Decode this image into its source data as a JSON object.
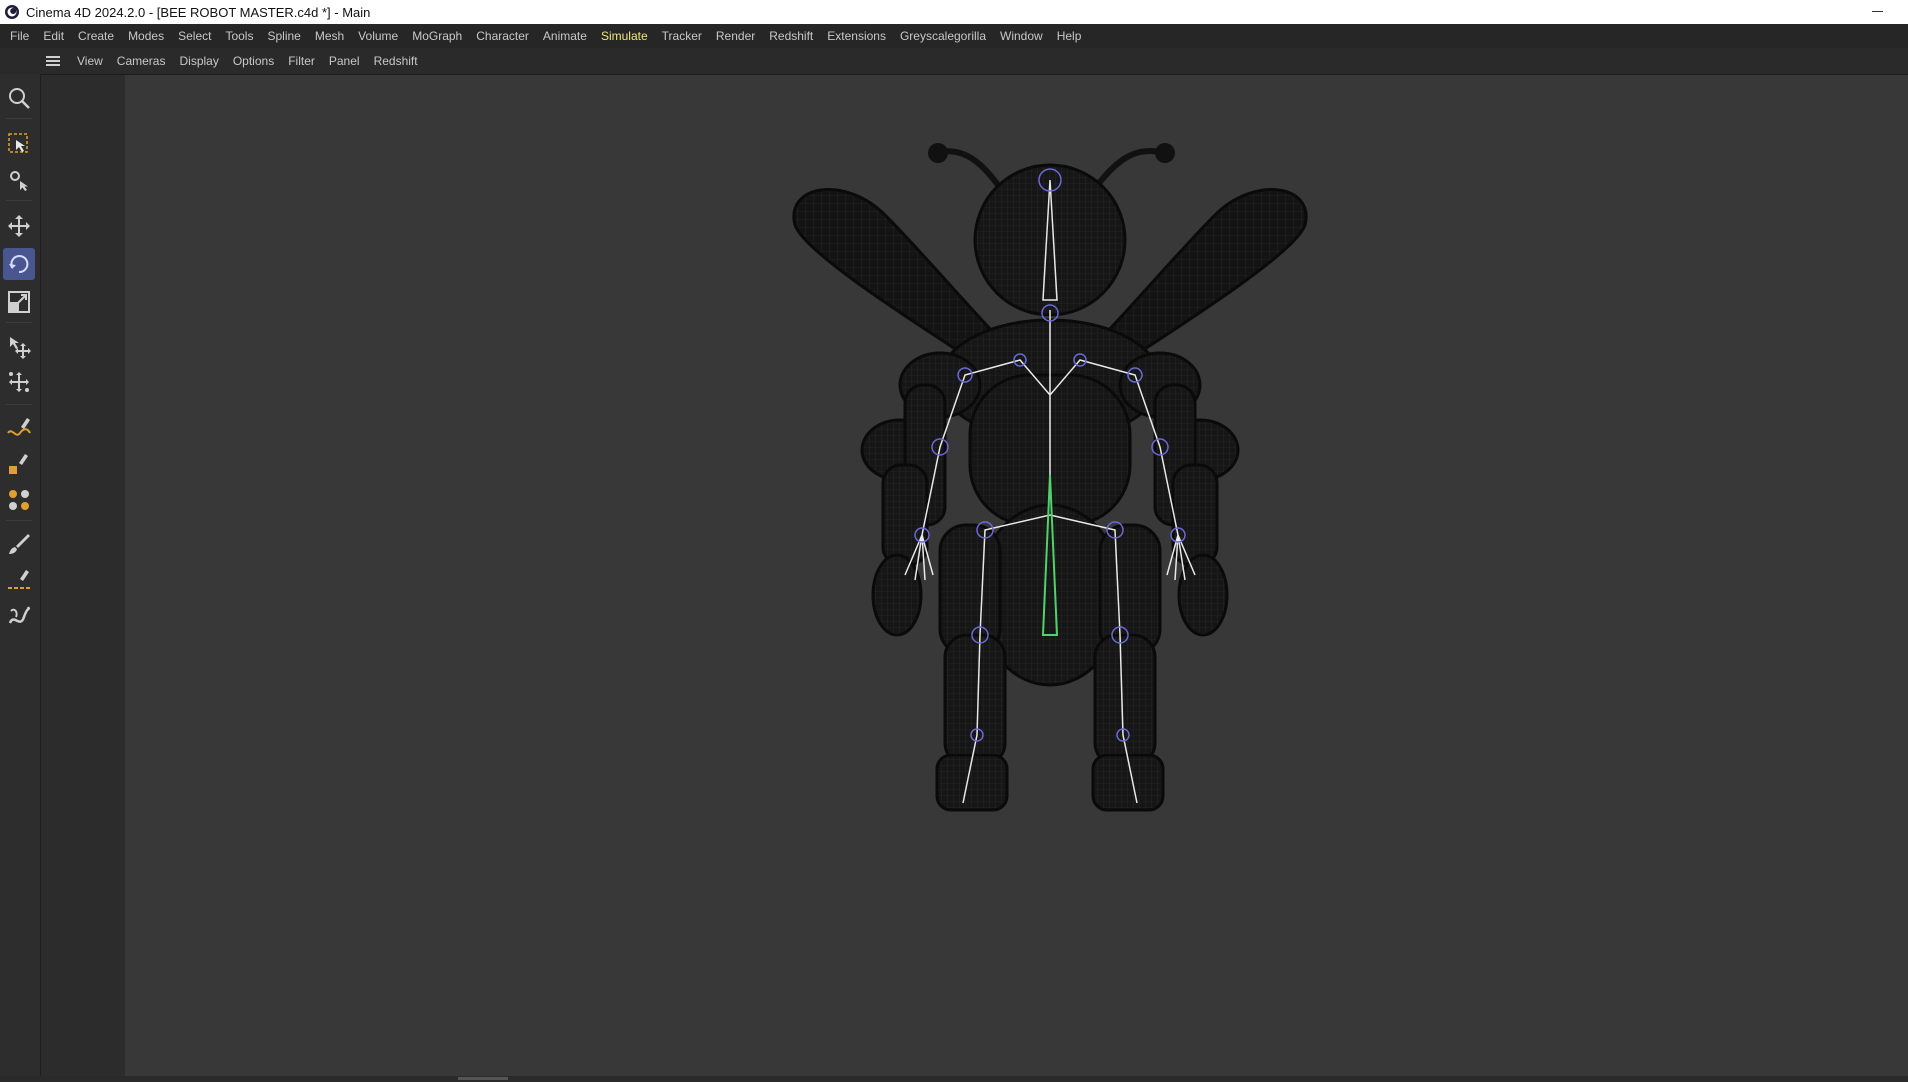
{
  "window": {
    "title": "Cinema 4D 2024.2.0 - [BEE ROBOT MASTER.c4d *] - Main"
  },
  "menu": {
    "items": [
      "File",
      "Edit",
      "Create",
      "Modes",
      "Select",
      "Tools",
      "Spline",
      "Mesh",
      "Volume",
      "MoGraph",
      "Character",
      "Animate",
      "Simulate",
      "Tracker",
      "Render",
      "Redshift",
      "Extensions",
      "Greyscalegorilla",
      "Window",
      "Help"
    ],
    "active": "Simulate"
  },
  "viewport_menu": {
    "items": [
      "View",
      "Cameras",
      "Display",
      "Options",
      "Filter",
      "Panel",
      "Redshift"
    ]
  },
  "tools": [
    {
      "name": "magnifier-icon"
    },
    {
      "name": "live-selection-icon"
    },
    {
      "name": "tweak-icon"
    },
    {
      "name": "move-icon"
    },
    {
      "name": "rotate-icon"
    },
    {
      "name": "scale-icon"
    },
    {
      "name": "axis-move-icon"
    },
    {
      "name": "transform-icon"
    },
    {
      "name": "spline-pen-icon"
    },
    {
      "name": "spline-primitive-icon"
    },
    {
      "name": "mograph-icon"
    },
    {
      "name": "brush-icon"
    },
    {
      "name": "sketch-pen-icon"
    },
    {
      "name": "sculpt-icon"
    }
  ],
  "active_tool": "rotate-icon",
  "colors": {
    "accent_active": "#4a5690",
    "highlight_menu": "#f2e67a",
    "joint_ring": "#6a6ad8",
    "spine_green": "#4fd36a",
    "bone_white": "#e8e8e8"
  }
}
